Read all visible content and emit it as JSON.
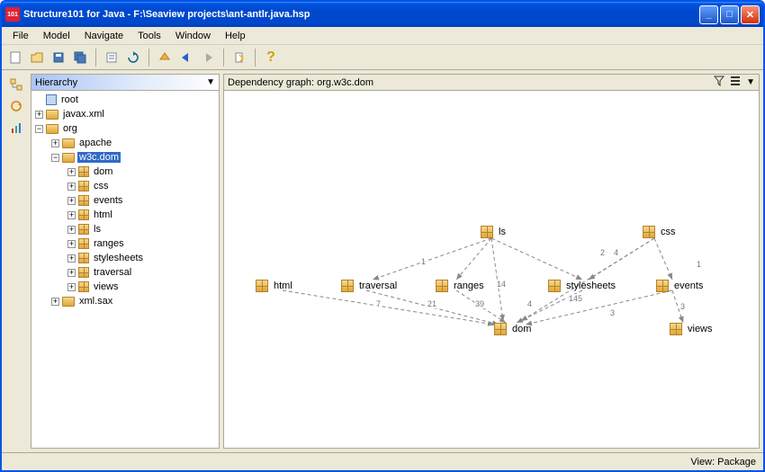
{
  "title": "Structure101 for Java - F:\\Seaview projects\\ant-antlr.java.hsp",
  "menu": [
    "File",
    "Model",
    "Navigate",
    "Tools",
    "Window",
    "Help"
  ],
  "panels": {
    "hierarchy_title": "Hierarchy",
    "graph_title": "Dependency graph: org.w3c.dom"
  },
  "tree": {
    "root": "root",
    "javax_xml": "javax.xml",
    "org": "org",
    "apache": "apache",
    "w3c_dom": "w3c.dom",
    "dom": "dom",
    "css": "css",
    "events": "events",
    "html": "html",
    "ls": "ls",
    "ranges": "ranges",
    "stylesheets": "stylesheets",
    "traversal": "traversal",
    "views": "views",
    "xml_sax": "xml.sax"
  },
  "graph": {
    "nodes": {
      "ls": "ls",
      "css": "css",
      "html": "html",
      "traversal": "traversal",
      "ranges": "ranges",
      "stylesheets": "stylesheets",
      "events": "events",
      "dom": "dom",
      "views": "views"
    },
    "edge_labels": {
      "ls_traversal": "1",
      "html_dom": "7",
      "traversal_dom": "21",
      "ranges_dom": "39",
      "ls_dom": "14",
      "stylesheets_dom": "145",
      "css_stylesheets": "2",
      "css_ss_4": "4",
      "events_dom": "3",
      "events_views": "3",
      "stylesheets_dom_4": "4",
      "css_events": "1"
    }
  },
  "status": "View: Package"
}
